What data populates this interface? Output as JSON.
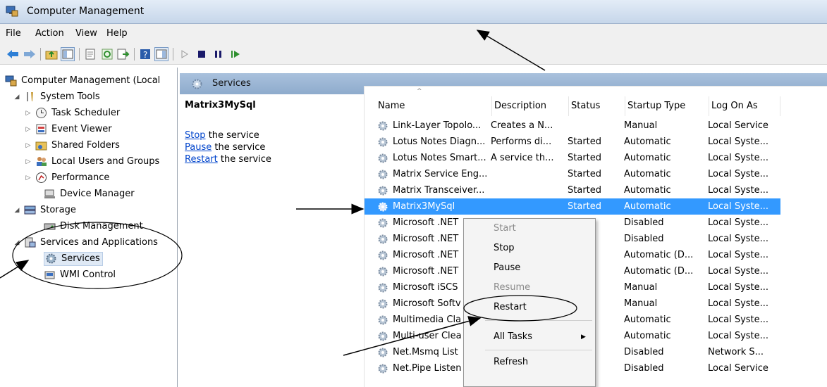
{
  "window": {
    "title": "Computer Management"
  },
  "menu": [
    "File",
    "Action",
    "View",
    "Help"
  ],
  "tree": {
    "root": "Computer Management (Local",
    "system_tools": "System Tools",
    "task_scheduler": "Task Scheduler",
    "event_viewer": "Event Viewer",
    "shared_folders": "Shared Folders",
    "local_users": "Local Users and Groups",
    "performance": "Performance",
    "device_manager": "Device Manager",
    "storage": "Storage",
    "disk_management": "Disk Management",
    "services_apps": "Services and Applications",
    "services": "Services",
    "wmi": "WMI Control"
  },
  "center": {
    "header": "Services",
    "selected_service": "Matrix3MySql",
    "stop_link": "Stop",
    "stop_rest": " the service",
    "pause_link": "Pause",
    "pause_rest": " the service",
    "restart_link": "Restart",
    "restart_rest": " the service"
  },
  "columns": [
    "Name",
    "Description",
    "Status",
    "Startup Type",
    "Log On As"
  ],
  "rows": [
    {
      "name": "Link-Layer Topolo...",
      "desc": "Creates a N...",
      "status": "",
      "startup": "Manual",
      "logon": "Local Service"
    },
    {
      "name": "Lotus Notes Diagn...",
      "desc": "Performs di...",
      "status": "Started",
      "startup": "Automatic",
      "logon": "Local Syste..."
    },
    {
      "name": "Lotus Notes Smart...",
      "desc": "A service th...",
      "status": "Started",
      "startup": "Automatic",
      "logon": "Local Syste..."
    },
    {
      "name": "Matrix Service Eng...",
      "desc": "",
      "status": "Started",
      "startup": "Automatic",
      "logon": "Local Syste..."
    },
    {
      "name": "Matrix Transceiver...",
      "desc": "",
      "status": "Started",
      "startup": "Automatic",
      "logon": "Local Syste..."
    },
    {
      "name": "Matrix3MySql",
      "desc": "",
      "status": "Started",
      "startup": "Automatic",
      "logon": "Local Syste..."
    },
    {
      "name": "Microsoft .NET",
      "desc": "",
      "status": "",
      "startup": "Disabled",
      "logon": "Local Syste..."
    },
    {
      "name": "Microsoft .NET",
      "desc": "",
      "status": "",
      "startup": "Disabled",
      "logon": "Local Syste..."
    },
    {
      "name": "Microsoft .NET",
      "desc": "",
      "status": "",
      "startup": "Automatic (D...",
      "logon": "Local Syste..."
    },
    {
      "name": "Microsoft .NET",
      "desc": "",
      "status": "",
      "startup": "Automatic (D...",
      "logon": "Local Syste..."
    },
    {
      "name": "Microsoft iSCS",
      "desc": "",
      "status": "",
      "startup": "Manual",
      "logon": "Local Syste..."
    },
    {
      "name": "Microsoft Softv",
      "desc": "",
      "status": "",
      "startup": "Manual",
      "logon": "Local Syste..."
    },
    {
      "name": "Multimedia Cla",
      "desc": "",
      "status": "ed",
      "startup": "Automatic",
      "logon": "Local Syste..."
    },
    {
      "name": "Multi-user Clea",
      "desc": "",
      "status": "ed",
      "startup": "Automatic",
      "logon": "Local Syste..."
    },
    {
      "name": "Net.Msmq List",
      "desc": "",
      "status": "",
      "startup": "Disabled",
      "logon": "Network S..."
    },
    {
      "name": "Net.Pipe Listen",
      "desc": "",
      "status": "",
      "startup": "Disabled",
      "logon": "Local Service"
    }
  ],
  "context_menu": {
    "start": "Start",
    "stop": "Stop",
    "pause": "Pause",
    "resume": "Resume",
    "restart": "Restart",
    "all_tasks": "All Tasks",
    "refresh": "Refresh"
  },
  "colors": {
    "selection": "#3399ff",
    "header": "#8eabcc",
    "link": "#0044cc"
  }
}
